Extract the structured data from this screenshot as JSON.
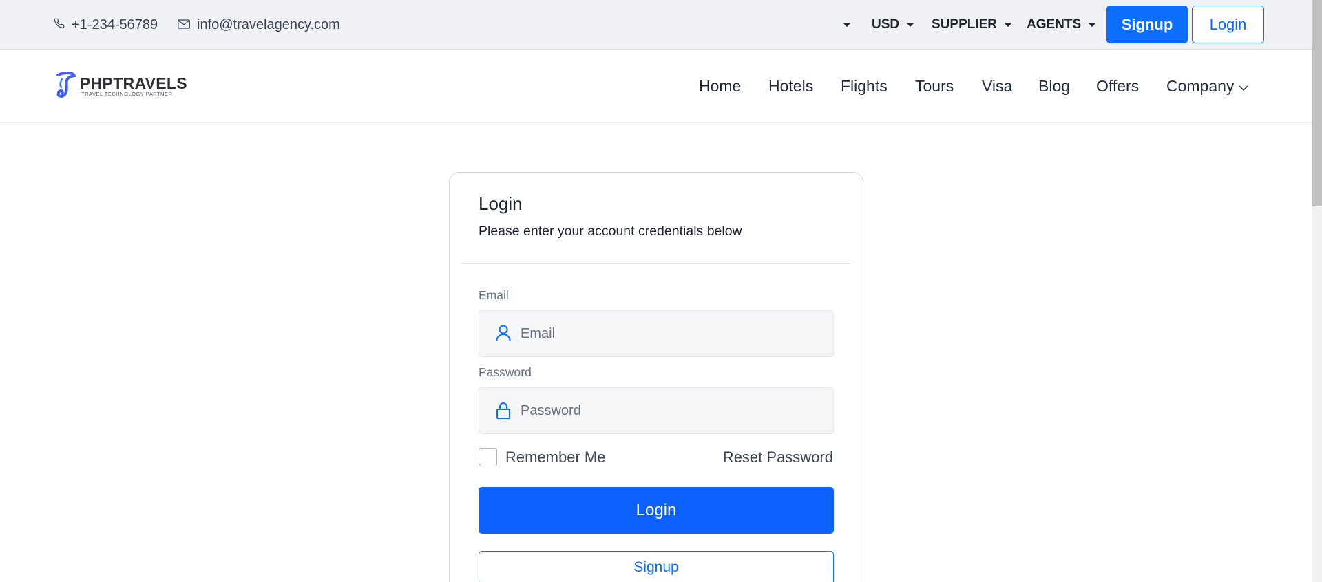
{
  "topbar": {
    "phone": "+1-234-56789",
    "email": "info@travelagency.com",
    "language_label": "",
    "currency": "USD",
    "supplier": "SUPPLIER",
    "agents": "AGENTS",
    "signup_label": "Signup",
    "login_label": "Login"
  },
  "brand": {
    "name": "PHPTRAVELS",
    "tagline": "TRAVEL TECHNOLOGY PARTNER"
  },
  "nav": {
    "items": [
      {
        "label": "Home"
      },
      {
        "label": "Hotels"
      },
      {
        "label": "Flights"
      },
      {
        "label": "Tours"
      },
      {
        "label": "Visa"
      },
      {
        "label": "Blog"
      },
      {
        "label": "Offers"
      },
      {
        "label": "Company"
      }
    ]
  },
  "login_card": {
    "title": "Login",
    "subtitle": "Please enter your account credentials below",
    "email_label": "Email",
    "email_placeholder": "Email",
    "email_value": "",
    "password_label": "Password",
    "password_placeholder": "Password",
    "password_value": "",
    "remember_label": "Remember Me",
    "remember_checked": false,
    "reset_label": "Reset Password",
    "login_button": "Login",
    "signup_button": "Signup"
  },
  "colors": {
    "primary": "#0d6efd",
    "login_button": "#0d61ff",
    "topbar_bg": "#eff1f5"
  },
  "icons": {
    "phone": "phone-icon",
    "email": "mail-icon",
    "user": "user-icon",
    "lock": "lock-icon",
    "company_chevron": "chevron-down-icon"
  }
}
